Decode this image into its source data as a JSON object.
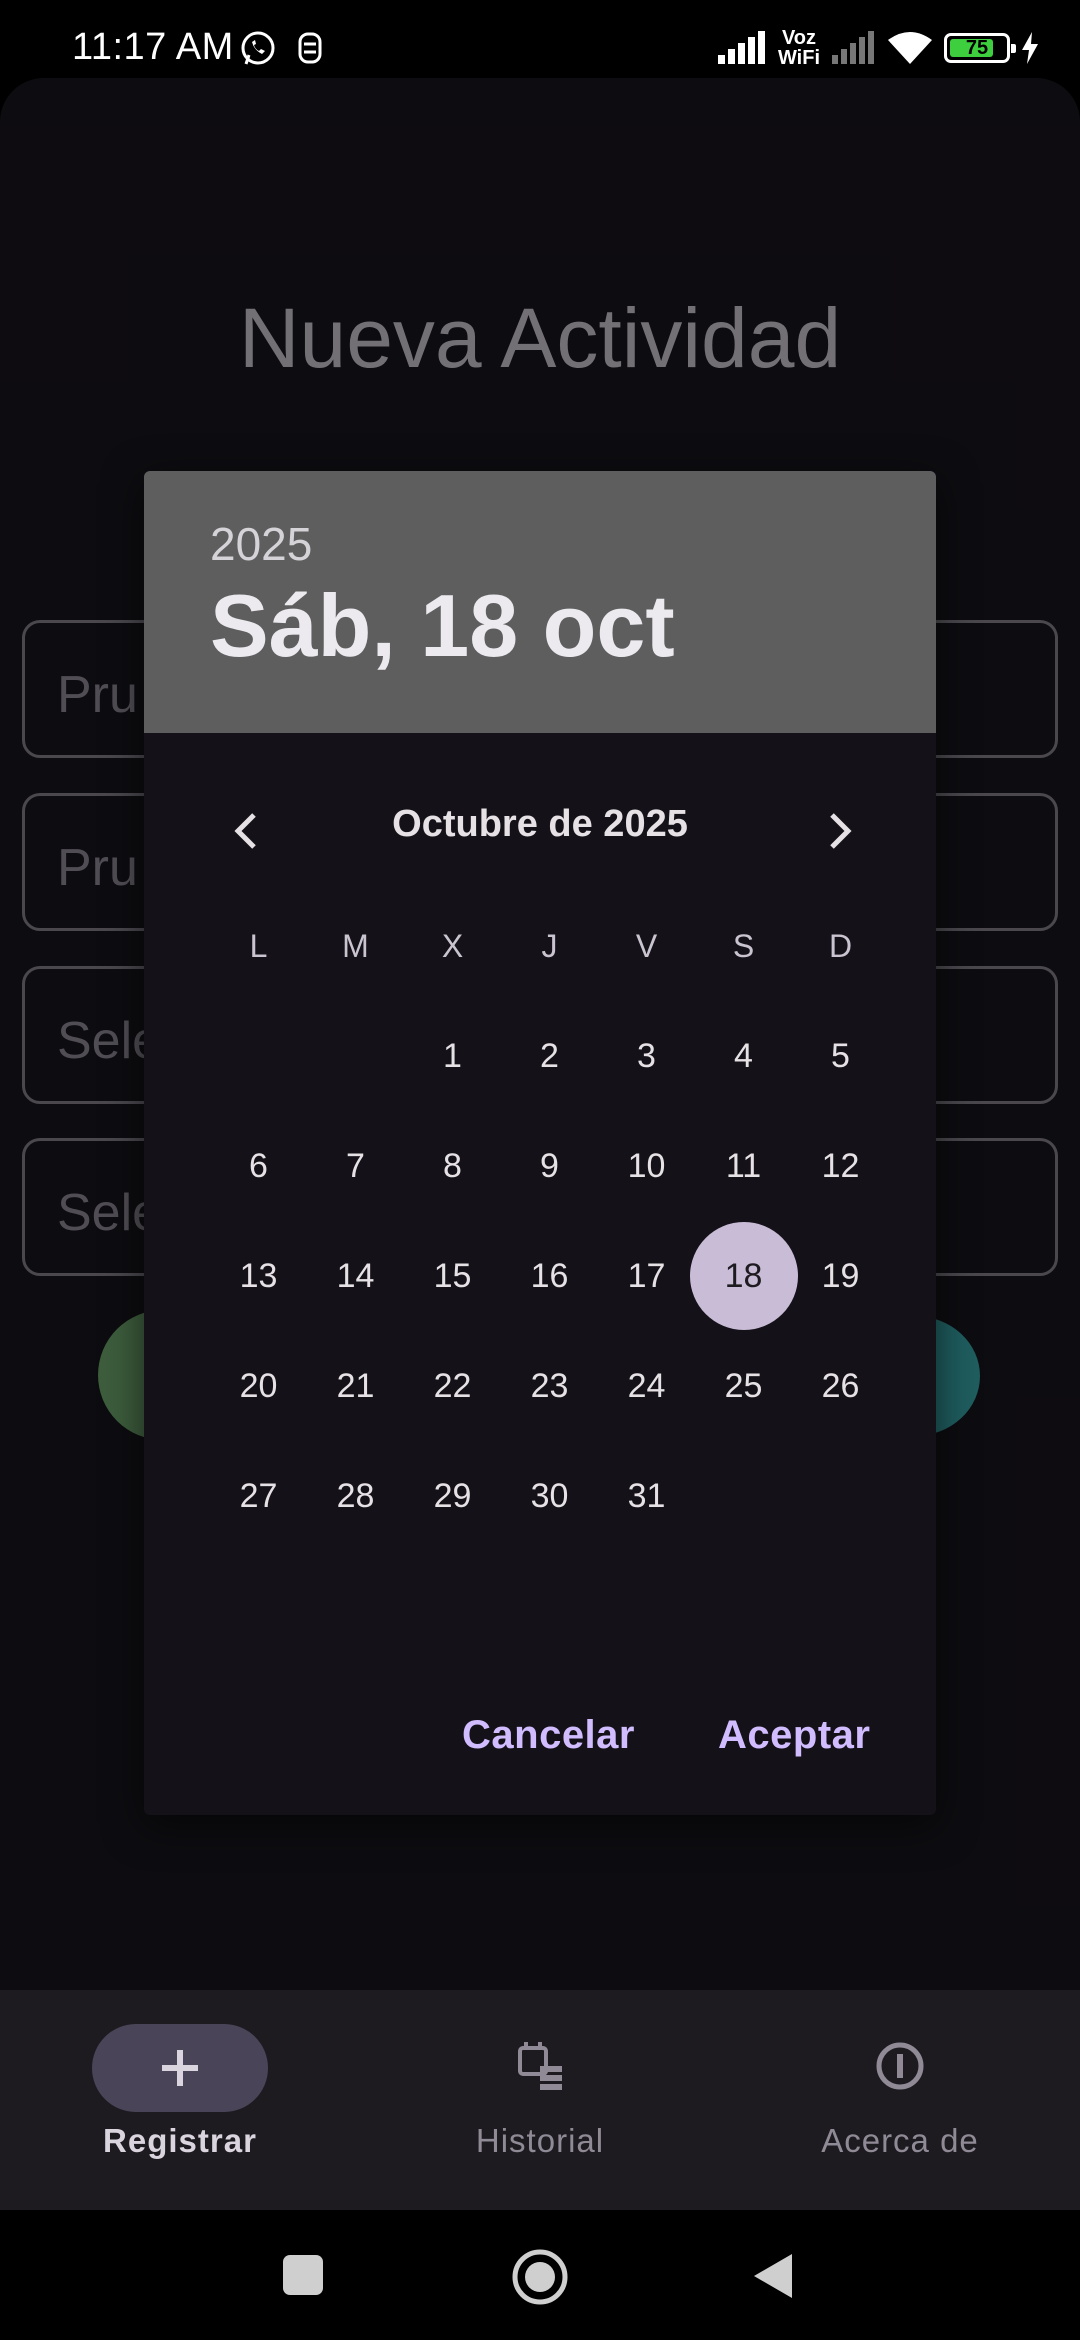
{
  "status_bar": {
    "time": "11:17 AM",
    "voz_line1": "Voz",
    "voz_line2": "WiFi",
    "battery": "75"
  },
  "page": {
    "title": "Nueva Actividad",
    "fields": [
      "Pru",
      "Pru",
      "Sele",
      "Sele"
    ]
  },
  "dialog": {
    "year": "2025",
    "date": "Sáb, 18 oct",
    "month_label": "Octubre de 2025",
    "weekdays": [
      "L",
      "M",
      "X",
      "J",
      "V",
      "S",
      "D"
    ],
    "weeks": [
      [
        "",
        "",
        "1",
        "2",
        "3",
        "4",
        "5"
      ],
      [
        "6",
        "7",
        "8",
        "9",
        "10",
        "11",
        "12"
      ],
      [
        "13",
        "14",
        "15",
        "16",
        "17",
        "18",
        "19"
      ],
      [
        "20",
        "21",
        "22",
        "23",
        "24",
        "25",
        "26"
      ],
      [
        "27",
        "28",
        "29",
        "30",
        "31",
        "",
        ""
      ]
    ],
    "selected_day": "18",
    "cancel_label": "Cancelar",
    "accept_label": "Aceptar"
  },
  "bottom_nav": {
    "items": [
      {
        "label": "Registrar",
        "icon": "plus-icon",
        "active": true
      },
      {
        "label": "Historial",
        "icon": "calendar-list-icon",
        "active": false
      },
      {
        "label": "Acerca de",
        "icon": "info-icon",
        "active": false
      }
    ]
  },
  "colors": {
    "accent": "#d0bcff",
    "selected_day_bg": "#d3c6e2",
    "dialog_header": "#5e5e5e",
    "surface": "#141218"
  }
}
